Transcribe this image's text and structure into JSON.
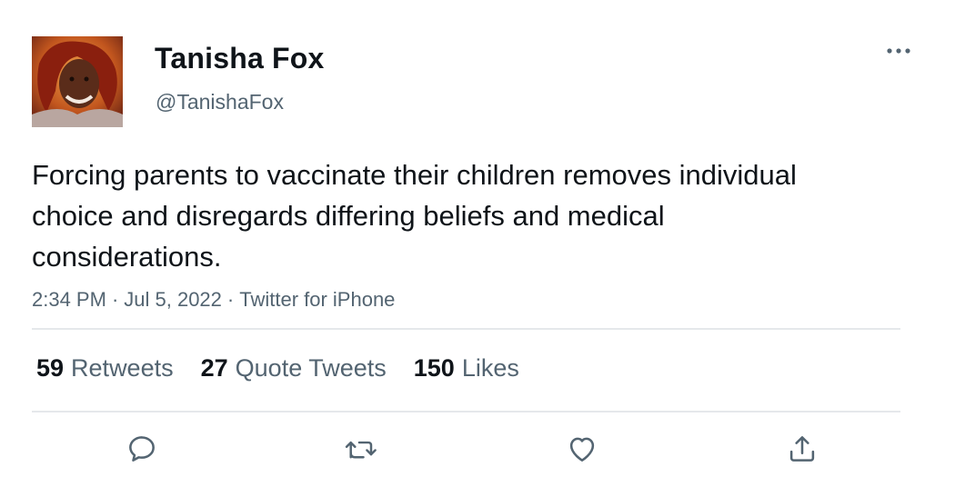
{
  "author": {
    "name": "Tanisha Fox",
    "handle": "@TanishaFox",
    "avatar_icon": "profile-photo"
  },
  "tweet": {
    "text": "Forcing parents to vaccinate their children removes individual choice and disregards differing beliefs and medical considerations.",
    "time": "2:34 PM",
    "date": "Jul 5, 2022",
    "source": "Twitter for iPhone",
    "separator": "·"
  },
  "stats": {
    "retweets": {
      "count": "59",
      "label": "Retweets"
    },
    "quote_tweets": {
      "count": "27",
      "label": "Quote Tweets"
    },
    "likes": {
      "count": "150",
      "label": "Likes"
    }
  },
  "actions": {
    "reply_icon": "reply-icon",
    "retweet_icon": "retweet-icon",
    "like_icon": "heart-icon",
    "share_icon": "share-icon",
    "more_icon": "more-icon"
  },
  "colors": {
    "text": "#0f1419",
    "secondary": "#536471",
    "divider": "#e5e8eb"
  }
}
